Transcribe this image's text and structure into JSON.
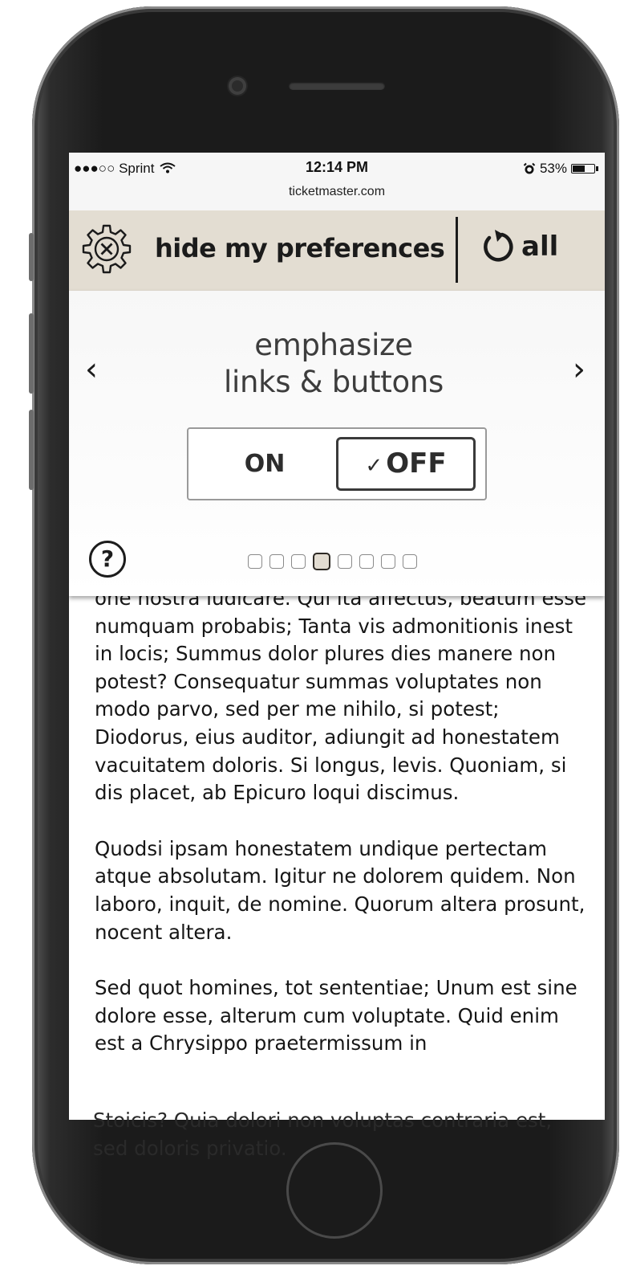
{
  "status_bar": {
    "carrier": "●●●○○ Sprint",
    "time": "12:14 PM",
    "url": "ticketmaster.com",
    "battery_text": "53%",
    "battery_level": 0.53
  },
  "preferences_bar": {
    "hide_label": "hide my preferences",
    "reset_label": "all"
  },
  "panel": {
    "prev": "‹",
    "next": "›",
    "setting_title_line1": "emphasize",
    "setting_title_line2": "links & buttons",
    "toggle": {
      "on_label": "ON",
      "off_check": "✓",
      "off_label": "OFF",
      "selected": "OFF"
    },
    "help_label": "?",
    "pager": {
      "total": 8,
      "current": 4
    }
  },
  "article": {
    "paragraphs": [
      "one nostra iudicare. Qui ita affectus, beatum esse numquam probabis; Tanta vis admonitionis inest in locis; Summus dolor plures dies manere non potest? Consequatur summas voluptates non modo parvo, sed per me nihilo, si potest; Diodorus, eius auditor, adiungit ad honestatem vacuitatem doloris. Si longus, levis. Quoniam, si dis placet, ab Epicuro loqui discimus.",
      "Quodsi ipsam honestatem undique pertectam atque absolutam. Igitur ne dolorem quidem. Non laboro, inquit, de nomine. Quorum altera prosunt, nocent altera.",
      "Sed quot homines, tot sententiae; Unum est sine dolore esse, alterum cum voluptate. Quid enim est a Chrysippo praetermissum in"
    ],
    "overflow_text": "Stoicis? Quia dolori non voluptas contraria est, sed doloris privatio."
  },
  "colors": {
    "pref_bar_bg": "#e3ddd2",
    "text": "#1b1b1b",
    "phone_body": "#1b1b1b"
  }
}
